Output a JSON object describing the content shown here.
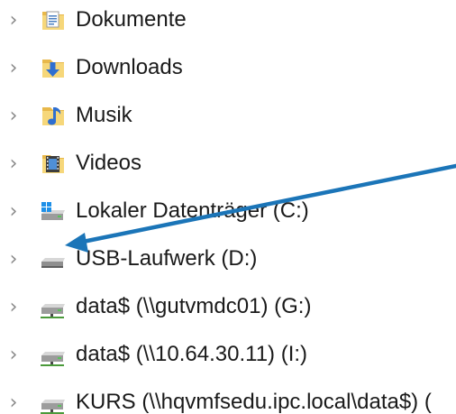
{
  "navigation_pane": {
    "items": [
      {
        "label": "Dokumente",
        "icon": "documents-folder-icon"
      },
      {
        "label": "Downloads",
        "icon": "downloads-folder-icon"
      },
      {
        "label": "Musik",
        "icon": "music-folder-icon"
      },
      {
        "label": "Videos",
        "icon": "videos-folder-icon"
      },
      {
        "label": "Lokaler Datenträger (C:)",
        "icon": "windows-drive-icon"
      },
      {
        "label": "USB-Laufwerk (D:)",
        "icon": "usb-drive-icon"
      },
      {
        "label": "data$ (\\\\gutvmdc01) (G:)",
        "icon": "network-drive-icon"
      },
      {
        "label": "data$ (\\\\10.64.30.11) (I:)",
        "icon": "network-drive-icon"
      },
      {
        "label": "KURS (\\\\hqvmfsedu.ipc.local\\data$) (",
        "icon": "network-drive-icon"
      }
    ]
  },
  "annotation": {
    "arrow_color": "#1b75b8",
    "points_to": "USB-Laufwerk (D:)"
  }
}
